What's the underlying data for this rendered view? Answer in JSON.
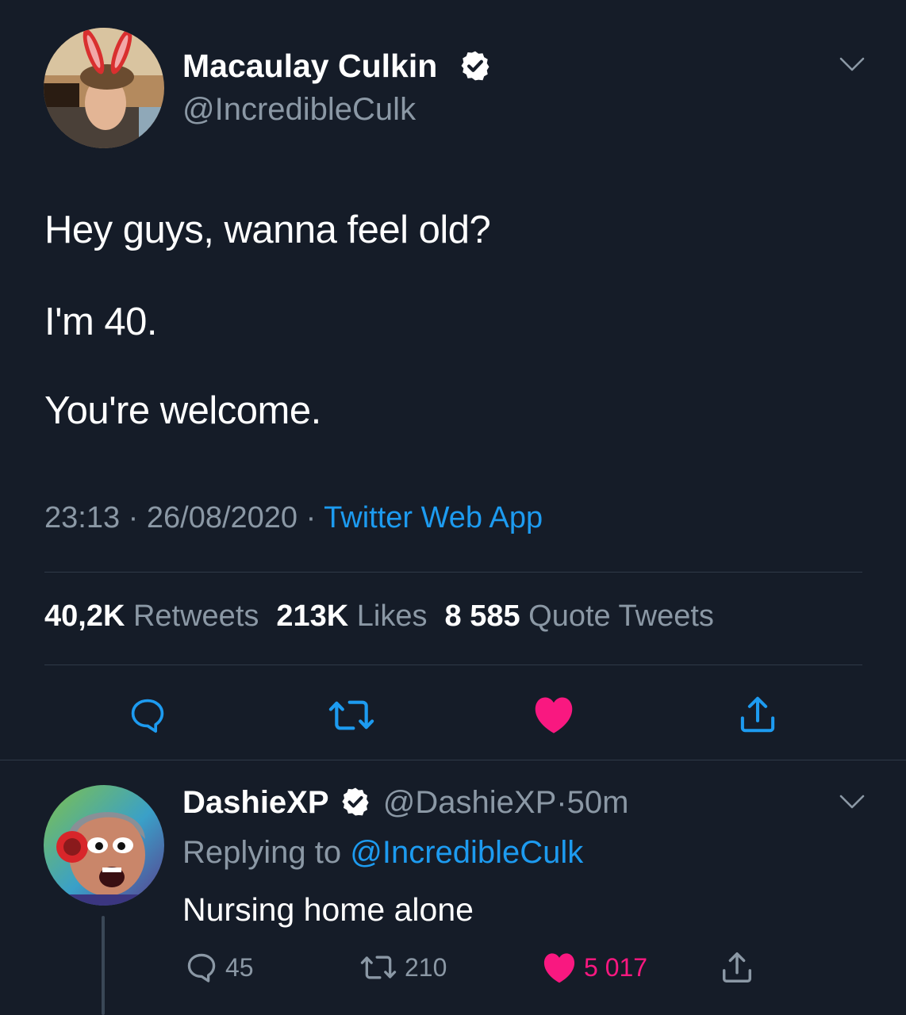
{
  "tweet": {
    "author_name": "Macaulay Culkin",
    "author_handle": "@IncredibleCulk",
    "lines": [
      "Hey guys, wanna feel old?",
      "I'm 40.",
      "You're welcome."
    ],
    "time": "23:13",
    "dot1": " · ",
    "date": "26/08/2020",
    "dot2": " · ",
    "source": "Twitter Web App",
    "stats": {
      "retweets_count": "40,2K",
      "retweets_label": "Retweets",
      "likes_count": "213K",
      "likes_label": "Likes",
      "quotes_count": "8 585",
      "quotes_label": "Quote Tweets"
    },
    "actions": [
      "reply-icon",
      "retweet-icon",
      "heart-icon",
      "share-icon"
    ],
    "liked": true
  },
  "reply": {
    "author_name": "DashieXP",
    "author_handle": "@DashieXP",
    "dot": "·",
    "age": "50m",
    "replying_prefix": "Replying to ",
    "replying_handle": "@IncredibleCulk",
    "text": "Nursing home alone",
    "replies": "45",
    "retweets": "210",
    "likes": "5 017"
  },
  "colors": {
    "background": "#151c28",
    "text": "#ffffff",
    "muted": "#8b98a5",
    "link": "#1d9bf0",
    "like": "#f91880",
    "divider": "#2f3a47"
  }
}
